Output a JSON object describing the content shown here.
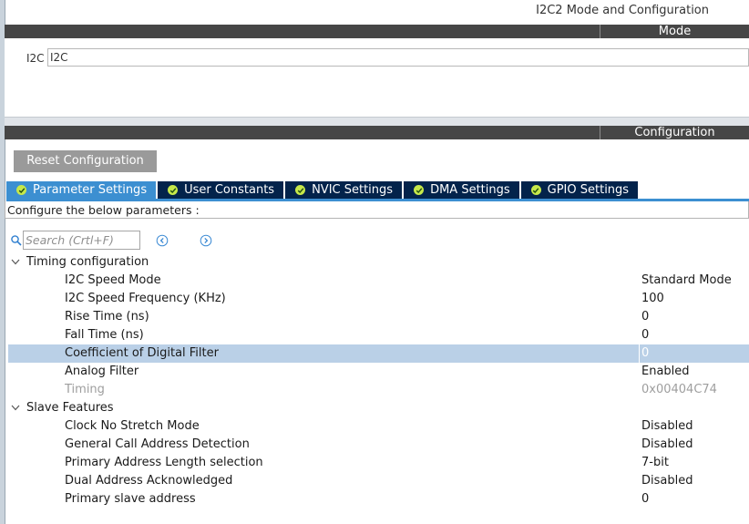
{
  "header": {
    "title": "I2C2 Mode and Configuration"
  },
  "mode": {
    "bar_label": "Mode",
    "i2c_label": "I2C",
    "i2c_value": "I2C"
  },
  "configuration": {
    "bar_label": "Configuration",
    "reset_button": "Reset Configuration",
    "tabs": [
      {
        "label": "Parameter Settings",
        "active": true
      },
      {
        "label": "User Constants",
        "active": false
      },
      {
        "label": "NVIC Settings",
        "active": false
      },
      {
        "label": "DMA Settings",
        "active": false
      },
      {
        "label": "GPIO Settings",
        "active": false
      }
    ],
    "panel_text": "Configure the below parameters :",
    "search": {
      "placeholder": "Search (Crtl+F)"
    },
    "groups": [
      {
        "label": "Timing configuration",
        "params": [
          {
            "label": "I2C Speed Mode",
            "value": "Standard Mode"
          },
          {
            "label": "I2C Speed Frequency (KHz)",
            "value": "100"
          },
          {
            "label": "Rise Time (ns)",
            "value": "0"
          },
          {
            "label": "Fall Time (ns)",
            "value": "0"
          },
          {
            "label": "Coefficient of Digital Filter",
            "value": "0"
          },
          {
            "label": "Analog Filter",
            "value": "Enabled"
          },
          {
            "label": "Timing",
            "value": "0x00404C74"
          }
        ]
      },
      {
        "label": "Slave Features",
        "params": [
          {
            "label": "Clock No Stretch Mode",
            "value": "Disabled"
          },
          {
            "label": "General Call Address Detection",
            "value": "Disabled"
          },
          {
            "label": "Primary Address Length selection",
            "value": "7-bit"
          },
          {
            "label": "Dual Address Acknowledged",
            "value": "Disabled"
          },
          {
            "label": "Primary slave address",
            "value": "0"
          }
        ]
      }
    ]
  },
  "colors": {
    "bar": "#464646",
    "tab": "#03234b",
    "tab_active": "#3c8fd1",
    "check": "#c6e84a",
    "selected_row": "#bad0e7"
  }
}
